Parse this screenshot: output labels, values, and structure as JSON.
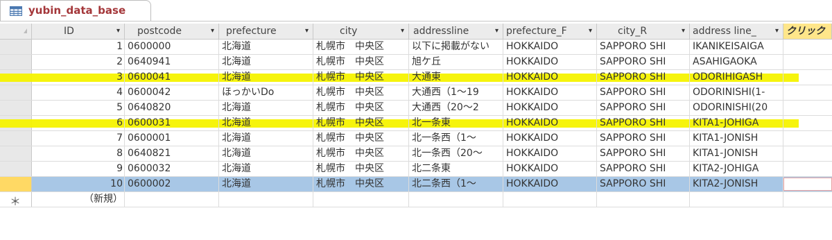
{
  "tab": {
    "title": "yubin_data_base",
    "icon": "table-icon"
  },
  "columns": [
    {
      "key": "id",
      "label": "ID"
    },
    {
      "key": "postcode",
      "label": "postcode"
    },
    {
      "key": "prefecture",
      "label": "prefecture"
    },
    {
      "key": "city",
      "label": "city"
    },
    {
      "key": "addressline",
      "label": "addressline"
    },
    {
      "key": "prefecture_r",
      "label": "prefecture_F"
    },
    {
      "key": "city_r",
      "label": "city_R"
    },
    {
      "key": "address_line_r",
      "label": "address line_"
    },
    {
      "key": "add",
      "label": "クリック"
    }
  ],
  "rows": [
    {
      "id": "1",
      "postcode": "0600000",
      "prefecture": "北海道",
      "city": "札幌市　中央区",
      "addressline": "以下に掲載がない",
      "prefecture_r": "HOKKAIDO",
      "city_r": "SAPPORO SHI",
      "address_line_r": "IKANIKEISAIGA"
    },
    {
      "id": "2",
      "postcode": "0640941",
      "prefecture": "北海道",
      "city": "札幌市　中央区",
      "addressline": "旭ケ丘",
      "prefecture_r": "HOKKAIDO",
      "city_r": "SAPPORO SHI",
      "address_line_r": "ASAHIGAOKA"
    },
    {
      "id": "3",
      "postcode": "0600041",
      "prefecture": "北海道",
      "city": "札幌市　中央区",
      "addressline": "大通東",
      "prefecture_r": "HOKKAIDO",
      "city_r": "SAPPORO SHI",
      "address_line_r": "ODORIHIGASH"
    },
    {
      "id": "4",
      "postcode": "0600042",
      "prefecture": "ほっかいDo",
      "city": "札幌市　中央区",
      "addressline": "大通西（1〜19",
      "prefecture_r": "HOKKAIDO",
      "city_r": "SAPPORO SHI",
      "address_line_r": "ODORINISHI(1-"
    },
    {
      "id": "5",
      "postcode": "0640820",
      "prefecture": "北海道",
      "city": "札幌市　中央区",
      "addressline": "大通西（20〜2",
      "prefecture_r": "HOKKAIDO",
      "city_r": "SAPPORO SHI",
      "address_line_r": "ODORINISHI(20"
    },
    {
      "id": "6",
      "postcode": "0600031",
      "prefecture": "北海道",
      "city": "札幌市　中央区",
      "addressline": "北一条東",
      "prefecture_r": "HOKKAIDO",
      "city_r": "SAPPORO SHI",
      "address_line_r": "KITA1-JOHIGA"
    },
    {
      "id": "7",
      "postcode": "0600001",
      "prefecture": "北海道",
      "city": "札幌市　中央区",
      "addressline": "北一条西（1〜",
      "prefecture_r": "HOKKAIDO",
      "city_r": "SAPPORO SHI",
      "address_line_r": "KITA1-JONISH"
    },
    {
      "id": "8",
      "postcode": "0640821",
      "prefecture": "北海道",
      "city": "札幌市　中央区",
      "addressline": "北一条西（20〜",
      "prefecture_r": "HOKKAIDO",
      "city_r": "SAPPORO SHI",
      "address_line_r": "KITA1-JONISH"
    },
    {
      "id": "9",
      "postcode": "0600032",
      "prefecture": "北海道",
      "city": "札幌市　中央区",
      "addressline": "北二条東",
      "prefecture_r": "HOKKAIDO",
      "city_r": "SAPPORO SHI",
      "address_line_r": "KITA2-JOHIGA"
    },
    {
      "id": "10",
      "postcode": "0600002",
      "prefecture": "北海道",
      "city": "札幌市　中央区",
      "addressline": "北二条西（1〜",
      "prefecture_r": "HOKKAIDO",
      "city_r": "SAPPORO SHI",
      "address_line_r": "KITA2-JONISH"
    }
  ],
  "new_row": {
    "marker": "＊",
    "id_label": "（新規）"
  },
  "colors": {
    "highlight": "#f5f300",
    "current_row": "#a8c7e6",
    "tab_title": "#a4373a",
    "add_column": "#ffe68a"
  }
}
